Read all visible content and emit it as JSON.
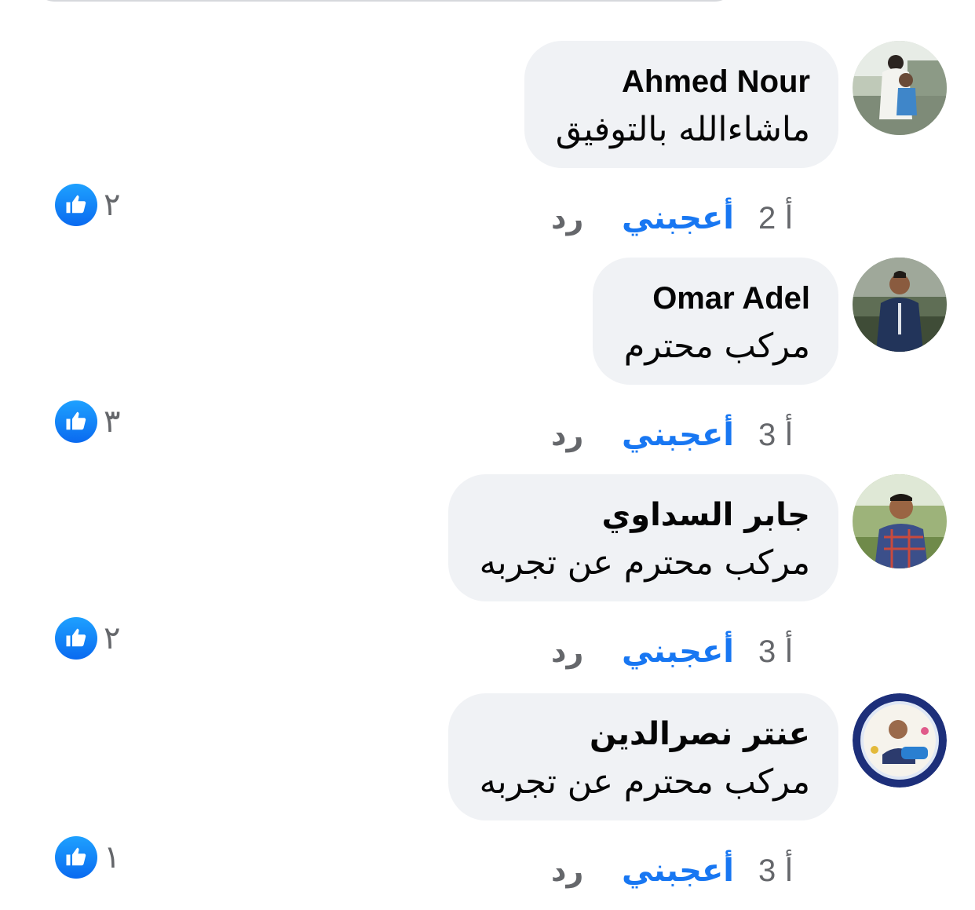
{
  "accent_color": "#1877f2",
  "comments": [
    {
      "author": "Ahmed Nour",
      "text": "ماشاءالله  بالتوفيق",
      "time": "2 أ",
      "like_label": "أعجبني",
      "reply_label": "رد",
      "reaction_count": "٢",
      "reaction_icon": "thumbs-up-icon"
    },
    {
      "author": "Omar Adel",
      "text": "مركب محترم",
      "time": "3 أ",
      "like_label": "أعجبني",
      "reply_label": "رد",
      "reaction_count": "٣",
      "reaction_icon": "thumbs-up-icon"
    },
    {
      "author": "جابر السداوي",
      "text": "مركب محترم عن تجربه",
      "time": "3 أ",
      "like_label": "أعجبني",
      "reply_label": "رد",
      "reaction_count": "٢",
      "reaction_icon": "thumbs-up-icon"
    },
    {
      "author": "عنتر نصرالدين",
      "text": "مركب محترم عن تجربه",
      "time": "3 أ",
      "like_label": "أعجبني",
      "reply_label": "رد",
      "reaction_count": "١",
      "reaction_icon": "thumbs-up-icon"
    }
  ]
}
